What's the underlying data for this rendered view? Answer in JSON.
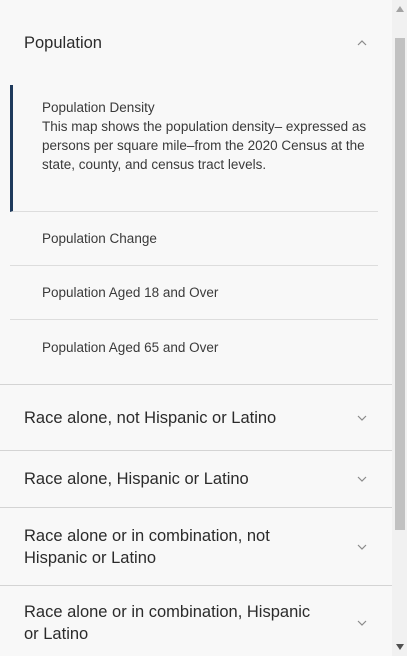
{
  "population": {
    "title": "Population",
    "items": [
      {
        "title": "Population Density",
        "description": "This map shows the population density– expressed as persons per square mile–from the 2020 Census at the state, county, and census tract levels."
      },
      {
        "title": "Population Change"
      },
      {
        "title": "Population Aged 18 and Over"
      },
      {
        "title": "Population Aged 65 and Over"
      }
    ]
  },
  "sections": [
    {
      "title": "Race alone, not Hispanic or Latino"
    },
    {
      "title": "Race alone, Hispanic or Latino"
    },
    {
      "title": "Race alone or in combination, not Hispanic or Latino"
    },
    {
      "title": "Race alone or in combination, Hispanic or Latino"
    }
  ],
  "icons": {
    "expanded": "chevron-up-icon",
    "collapsed": "chevron-down-icon"
  }
}
